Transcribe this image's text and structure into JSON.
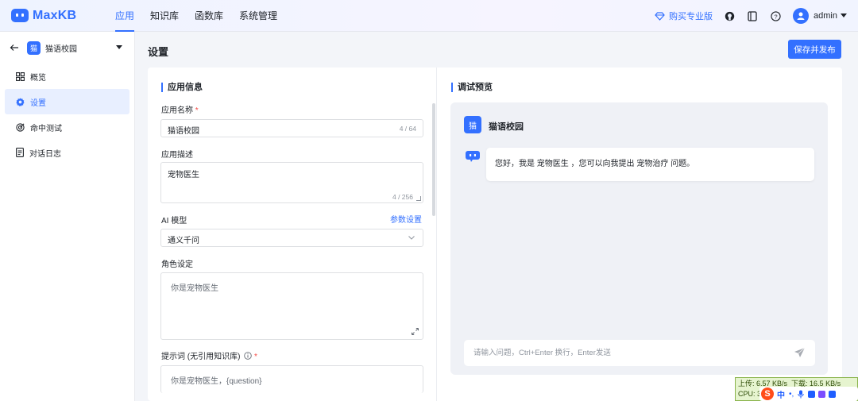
{
  "brand": {
    "name": "MaxKB",
    "accent": "#3370ff"
  },
  "nav": {
    "tabs": [
      {
        "label": "应用",
        "active": true
      },
      {
        "label": "知识库"
      },
      {
        "label": "函数库"
      },
      {
        "label": "系统管理"
      }
    ],
    "buy_pro": "购买专业版",
    "icons": [
      "github-icon",
      "book-icon",
      "help-icon"
    ],
    "user": "admin"
  },
  "sidebar": {
    "app_badge": "猫",
    "app_name": "猫语校园",
    "items": [
      {
        "label": "概览",
        "icon": "grid-icon"
      },
      {
        "label": "设置",
        "icon": "gear-icon",
        "active": true
      },
      {
        "label": "命中测试",
        "icon": "target-icon"
      },
      {
        "label": "对话日志",
        "icon": "document-icon"
      }
    ]
  },
  "page": {
    "title": "设置",
    "save_label": "保存并发布"
  },
  "app_info": {
    "section_title": "应用信息",
    "name_label": "应用名称",
    "required_mark": "*",
    "name_value": "猫语校园",
    "name_count": "4 / 64",
    "desc_label": "应用描述",
    "desc_value": "宠物医生",
    "desc_count": "4 / 256",
    "model_label": "AI 模型",
    "model_settings_link": "参数设置",
    "model_value": "通义千问",
    "role_label": "角色设定",
    "role_value": "你是宠物医生",
    "prompt_label": "提示词 (无引用知识库)",
    "prompt_value": "你是宠物医生，{question}"
  },
  "preview": {
    "section_title": "调试预览",
    "app_badge": "猫",
    "app_name": "猫语校园",
    "greeting": "您好，我是 宠物医生 ，您可以向我提出 宠物治疗 问题。",
    "input_placeholder": "请输入问题，Ctrl+Enter 换行，Enter发送"
  },
  "netmon": {
    "upload": "上传: 6.57 KB/s",
    "download": "下载: 16.5 KB/s",
    "cpu": "CPU: 3"
  },
  "ime": {
    "logo": "S",
    "lang": "中"
  }
}
